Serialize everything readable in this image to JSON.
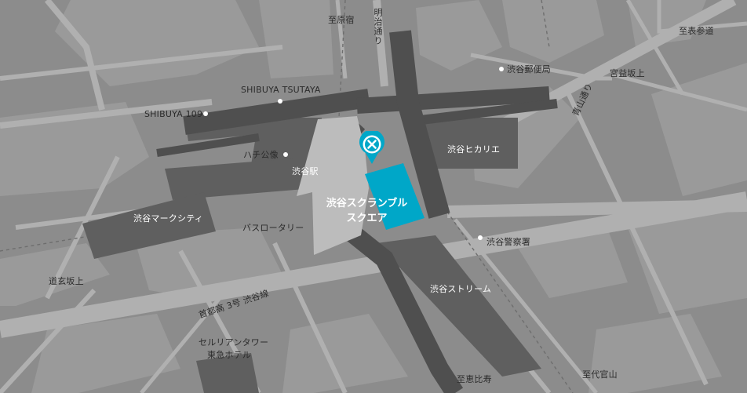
{
  "map": {
    "colors": {
      "background": "#8c8c8c",
      "block": "#9a9a9a",
      "road": "#b0b0b0",
      "rail": "#4f4f4f",
      "station_area": "#5f5f5f",
      "venue": "#00a7c8",
      "station": "#bcbcbc"
    },
    "venue": {
      "name_line1": "渋谷スクランブル",
      "name_line2": "スクエア",
      "marker_icon": "x-marker-icon"
    },
    "labels": {
      "harajuku": "至原宿",
      "meiji_dori": "明治通り",
      "omotesando": "至表参道",
      "post_office": "渋谷郵便局",
      "miyamasuzaka": "宮益坂上",
      "aoyama_dori": "青山通り",
      "tsutaya": "SHIBUYA TSUTAYA",
      "shibuya109": "SHIBUYA 109",
      "hachiko": "ハチ公像",
      "shibuya_station": "渋谷駅",
      "hikarie": "渋谷ヒカリエ",
      "mark_city": "渋谷マークシティ",
      "bus_rotary": "バスロータリー",
      "police": "渋谷警察署",
      "dogenzaka": "道玄坂上",
      "expressway": "首都高 3号 渋谷線",
      "stream": "渋谷ストリーム",
      "cerulean_line1": "セルリアンタワー",
      "cerulean_line2": "東急ホテル",
      "ebisu": "至恵比寿",
      "daikanyama": "至代官山"
    }
  }
}
